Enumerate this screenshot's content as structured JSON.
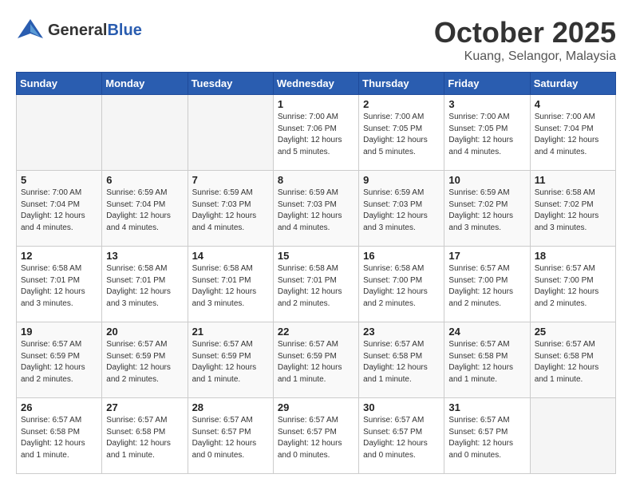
{
  "header": {
    "logo_general": "General",
    "logo_blue": "Blue",
    "month": "October 2025",
    "location": "Kuang, Selangor, Malaysia"
  },
  "weekdays": [
    "Sunday",
    "Monday",
    "Tuesday",
    "Wednesday",
    "Thursday",
    "Friday",
    "Saturday"
  ],
  "weeks": [
    [
      {
        "day": "",
        "info": ""
      },
      {
        "day": "",
        "info": ""
      },
      {
        "day": "",
        "info": ""
      },
      {
        "day": "1",
        "info": "Sunrise: 7:00 AM\nSunset: 7:06 PM\nDaylight: 12 hours\nand 5 minutes."
      },
      {
        "day": "2",
        "info": "Sunrise: 7:00 AM\nSunset: 7:05 PM\nDaylight: 12 hours\nand 5 minutes."
      },
      {
        "day": "3",
        "info": "Sunrise: 7:00 AM\nSunset: 7:05 PM\nDaylight: 12 hours\nand 4 minutes."
      },
      {
        "day": "4",
        "info": "Sunrise: 7:00 AM\nSunset: 7:04 PM\nDaylight: 12 hours\nand 4 minutes."
      }
    ],
    [
      {
        "day": "5",
        "info": "Sunrise: 7:00 AM\nSunset: 7:04 PM\nDaylight: 12 hours\nand 4 minutes."
      },
      {
        "day": "6",
        "info": "Sunrise: 6:59 AM\nSunset: 7:04 PM\nDaylight: 12 hours\nand 4 minutes."
      },
      {
        "day": "7",
        "info": "Sunrise: 6:59 AM\nSunset: 7:03 PM\nDaylight: 12 hours\nand 4 minutes."
      },
      {
        "day": "8",
        "info": "Sunrise: 6:59 AM\nSunset: 7:03 PM\nDaylight: 12 hours\nand 4 minutes."
      },
      {
        "day": "9",
        "info": "Sunrise: 6:59 AM\nSunset: 7:03 PM\nDaylight: 12 hours\nand 3 minutes."
      },
      {
        "day": "10",
        "info": "Sunrise: 6:59 AM\nSunset: 7:02 PM\nDaylight: 12 hours\nand 3 minutes."
      },
      {
        "day": "11",
        "info": "Sunrise: 6:58 AM\nSunset: 7:02 PM\nDaylight: 12 hours\nand 3 minutes."
      }
    ],
    [
      {
        "day": "12",
        "info": "Sunrise: 6:58 AM\nSunset: 7:01 PM\nDaylight: 12 hours\nand 3 minutes."
      },
      {
        "day": "13",
        "info": "Sunrise: 6:58 AM\nSunset: 7:01 PM\nDaylight: 12 hours\nand 3 minutes."
      },
      {
        "day": "14",
        "info": "Sunrise: 6:58 AM\nSunset: 7:01 PM\nDaylight: 12 hours\nand 3 minutes."
      },
      {
        "day": "15",
        "info": "Sunrise: 6:58 AM\nSunset: 7:01 PM\nDaylight: 12 hours\nand 2 minutes."
      },
      {
        "day": "16",
        "info": "Sunrise: 6:58 AM\nSunset: 7:00 PM\nDaylight: 12 hours\nand 2 minutes."
      },
      {
        "day": "17",
        "info": "Sunrise: 6:57 AM\nSunset: 7:00 PM\nDaylight: 12 hours\nand 2 minutes."
      },
      {
        "day": "18",
        "info": "Sunrise: 6:57 AM\nSunset: 7:00 PM\nDaylight: 12 hours\nand 2 minutes."
      }
    ],
    [
      {
        "day": "19",
        "info": "Sunrise: 6:57 AM\nSunset: 6:59 PM\nDaylight: 12 hours\nand 2 minutes."
      },
      {
        "day": "20",
        "info": "Sunrise: 6:57 AM\nSunset: 6:59 PM\nDaylight: 12 hours\nand 2 minutes."
      },
      {
        "day": "21",
        "info": "Sunrise: 6:57 AM\nSunset: 6:59 PM\nDaylight: 12 hours\nand 1 minute."
      },
      {
        "day": "22",
        "info": "Sunrise: 6:57 AM\nSunset: 6:59 PM\nDaylight: 12 hours\nand 1 minute."
      },
      {
        "day": "23",
        "info": "Sunrise: 6:57 AM\nSunset: 6:58 PM\nDaylight: 12 hours\nand 1 minute."
      },
      {
        "day": "24",
        "info": "Sunrise: 6:57 AM\nSunset: 6:58 PM\nDaylight: 12 hours\nand 1 minute."
      },
      {
        "day": "25",
        "info": "Sunrise: 6:57 AM\nSunset: 6:58 PM\nDaylight: 12 hours\nand 1 minute."
      }
    ],
    [
      {
        "day": "26",
        "info": "Sunrise: 6:57 AM\nSunset: 6:58 PM\nDaylight: 12 hours\nand 1 minute."
      },
      {
        "day": "27",
        "info": "Sunrise: 6:57 AM\nSunset: 6:58 PM\nDaylight: 12 hours\nand 1 minute."
      },
      {
        "day": "28",
        "info": "Sunrise: 6:57 AM\nSunset: 6:57 PM\nDaylight: 12 hours\nand 0 minutes."
      },
      {
        "day": "29",
        "info": "Sunrise: 6:57 AM\nSunset: 6:57 PM\nDaylight: 12 hours\nand 0 minutes."
      },
      {
        "day": "30",
        "info": "Sunrise: 6:57 AM\nSunset: 6:57 PM\nDaylight: 12 hours\nand 0 minutes."
      },
      {
        "day": "31",
        "info": "Sunrise: 6:57 AM\nSunset: 6:57 PM\nDaylight: 12 hours\nand 0 minutes."
      },
      {
        "day": "",
        "info": ""
      }
    ]
  ]
}
